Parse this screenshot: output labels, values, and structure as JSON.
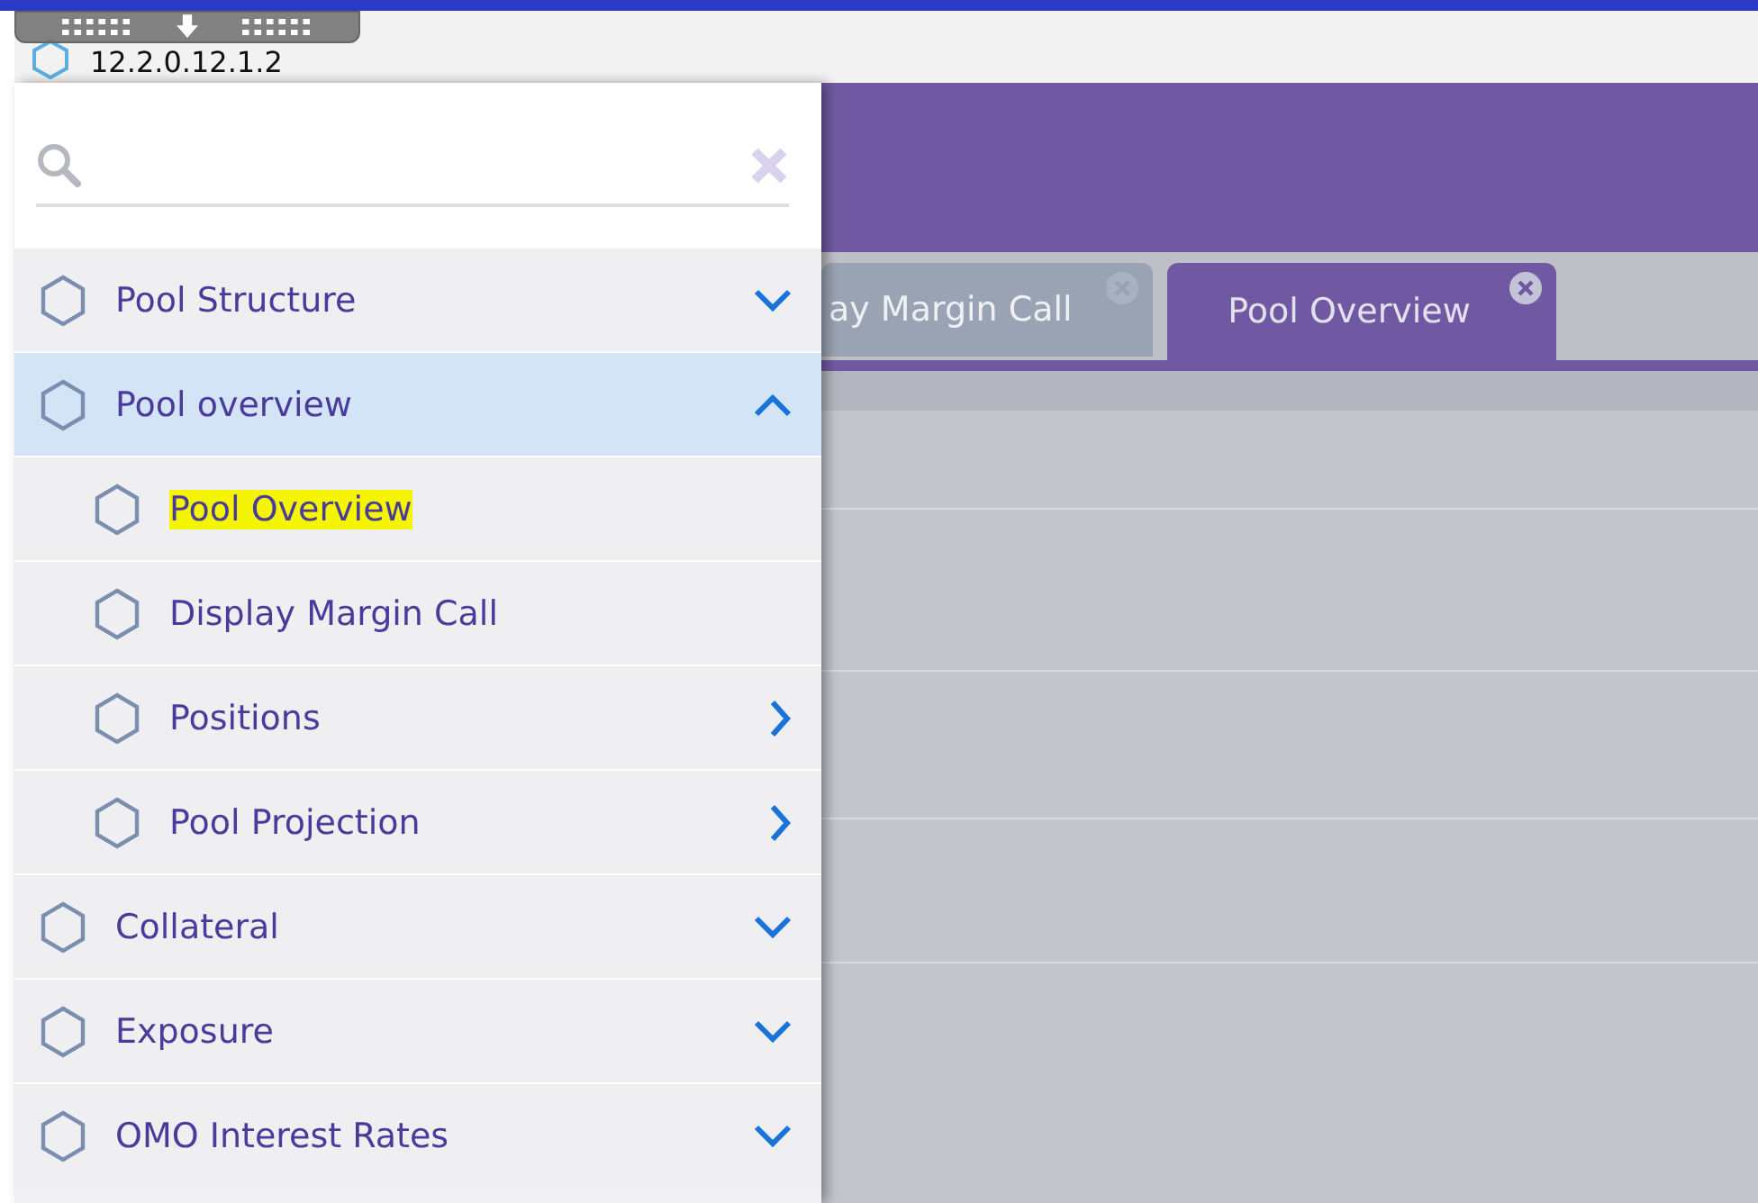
{
  "address_bar": {
    "address": "12.2.0.12.1.2"
  },
  "menu": [
    {
      "label": "Pool Structure",
      "expanded": false,
      "selected": false
    },
    {
      "label": "Pool overview",
      "expanded": true,
      "selected": true,
      "children": [
        {
          "label": "Pool Overview",
          "highlighted": true,
          "has_submenu": false
        },
        {
          "label": "Display Margin Call",
          "highlighted": false,
          "has_submenu": false
        },
        {
          "label": "Positions",
          "highlighted": false,
          "has_submenu": true
        },
        {
          "label": "Pool Projection",
          "highlighted": false,
          "has_submenu": true
        }
      ]
    },
    {
      "label": "Collateral",
      "expanded": false,
      "selected": false
    },
    {
      "label": "Exposure",
      "expanded": false,
      "selected": false
    },
    {
      "label": "OMO Interest Rates",
      "expanded": false,
      "selected": false
    }
  ],
  "tabs": [
    {
      "label": "ay Margin Call",
      "selected": false
    },
    {
      "label": "Pool Overview",
      "selected": true
    }
  ]
}
